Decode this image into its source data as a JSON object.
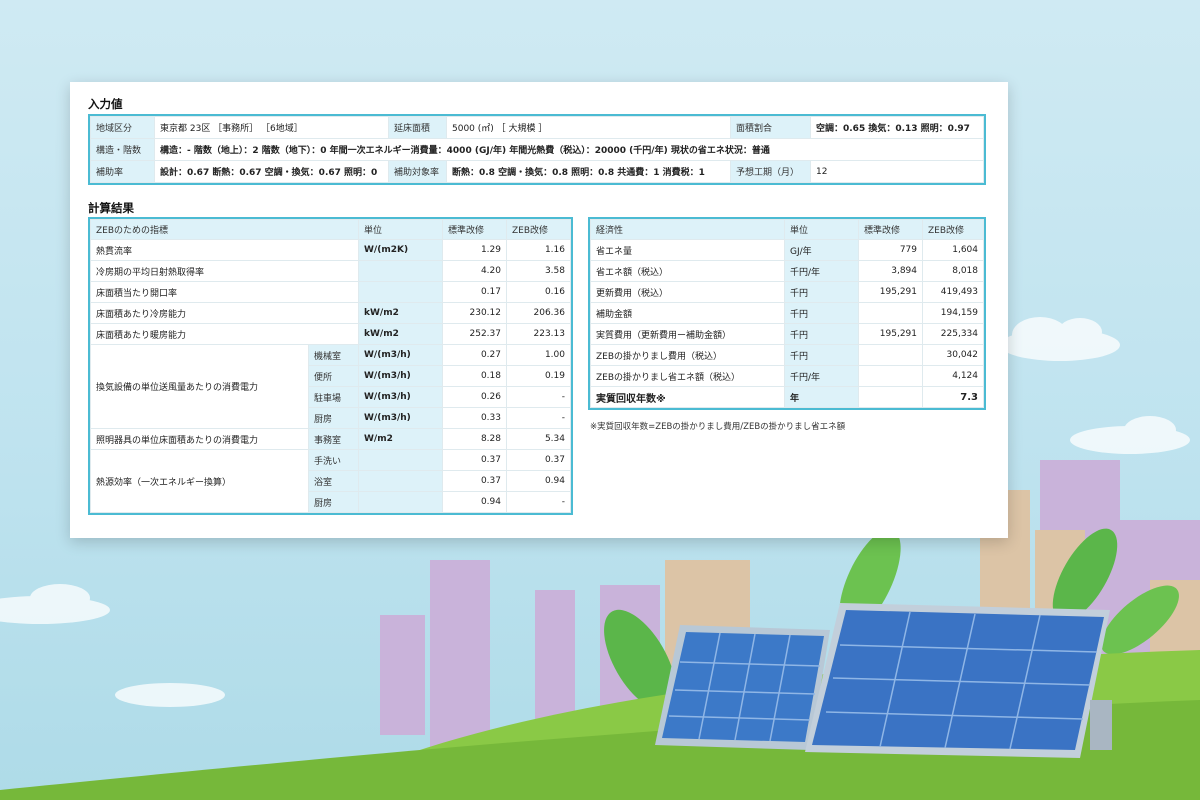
{
  "input": {
    "title": "入力値",
    "row1": {
      "region_label": "地域区分",
      "region_value": "東京都 23区 ［事務所］ ［6地域］",
      "floor_label": "延床面積",
      "floor_value": "5000 (㎡) ［ 大規模 ］",
      "ratio_label": "面積割合",
      "ratio_value": "空調：0.65 換気：0.13 照明：0.97"
    },
    "row2": {
      "structure_label": "構造・階数",
      "structure_value": "構造：- 階数（地上）：2 階数（地下）：0 年間一次エネルギー消費量：4000 (GJ/年) 年間光熱費（税込）：20000 (千円/年) 現状の省エネ状況：普通"
    },
    "row3": {
      "subsidy_label": "補助率",
      "subsidy_value": "設計：0.67 断熱：0.67 空調・換気：0.67 照明：0",
      "target_label": "補助対象率",
      "target_value": "断熱：0.8 空調・換気：0.8 照明：0.8 共通費：1 消費税：1",
      "period_label": "予想工期（月）",
      "period_value": "12"
    }
  },
  "results": {
    "title": "計算結果",
    "left": {
      "headers": [
        "ZEBのための指標",
        "単位",
        "標準改修",
        "ZEB改修"
      ],
      "rows": [
        {
          "name": "熱貫流率",
          "unit": "W/(m2K)",
          "std": "1.29",
          "zeb": "1.16"
        },
        {
          "name": "冷房期の平均日射熱取得率",
          "unit": "",
          "std": "4.20",
          "zeb": "3.58"
        },
        {
          "name": "床面積当たり開口率",
          "unit": "",
          "std": "0.17",
          "zeb": "0.16"
        },
        {
          "name": "床面積あたり冷房能力",
          "unit": "kW/m2",
          "std": "230.12",
          "zeb": "206.36"
        },
        {
          "name": "床面積あたり暖房能力",
          "unit": "kW/m2",
          "std": "252.37",
          "zeb": "223.13"
        }
      ],
      "vent_group": {
        "name": "換気設備の単位送風量あたりの消費電力",
        "rows": [
          {
            "sub": "機械室",
            "unit": "W/(m3/h)",
            "std": "0.27",
            "zeb": "1.00"
          },
          {
            "sub": "便所",
            "unit": "W/(m3/h)",
            "std": "0.18",
            "zeb": "0.19"
          },
          {
            "sub": "駐車場",
            "unit": "W/(m3/h)",
            "std": "0.26",
            "zeb": "-"
          },
          {
            "sub": "厨房",
            "unit": "W/(m3/h)",
            "std": "0.33",
            "zeb": "-"
          }
        ]
      },
      "light_row": {
        "name": "照明器具の単位床面積あたりの消費電力",
        "sub": "事務室",
        "unit": "W/m2",
        "std": "8.28",
        "zeb": "5.34"
      },
      "heat_group": {
        "name": "熱源効率（一次エネルギー換算）",
        "rows": [
          {
            "sub": "手洗い",
            "unit": "",
            "std": "0.37",
            "zeb": "0.37"
          },
          {
            "sub": "浴室",
            "unit": "",
            "std": "0.37",
            "zeb": "0.94"
          },
          {
            "sub": "厨房",
            "unit": "",
            "std": "0.94",
            "zeb": "-"
          }
        ]
      }
    },
    "right": {
      "headers": [
        "経済性",
        "単位",
        "標準改修",
        "ZEB改修"
      ],
      "rows": [
        {
          "name": "省エネ量",
          "unit": "GJ/年",
          "std": "779",
          "zeb": "1,604"
        },
        {
          "name": "省エネ額（税込）",
          "unit": "千円/年",
          "std": "3,894",
          "zeb": "8,018"
        },
        {
          "name": "更新費用（税込）",
          "unit": "千円",
          "std": "195,291",
          "zeb": "419,493"
        },
        {
          "name": "補助金額",
          "unit": "千円",
          "std": "",
          "zeb": "194,159"
        },
        {
          "name": "実質費用（更新費用ー補助金額）",
          "unit": "千円",
          "std": "195,291",
          "zeb": "225,334"
        },
        {
          "name": "ZEBの掛かりまし費用（税込）",
          "unit": "千円",
          "std": "",
          "zeb": "30,042"
        },
        {
          "name": "ZEBの掛かりまし省エネ額（税込）",
          "unit": "千円/年",
          "std": "",
          "zeb": "4,124"
        },
        {
          "name": "実質回収年数※",
          "unit": "年",
          "std": "",
          "zeb": "7.3"
        }
      ],
      "note": "※実質回収年数=ZEBの掛かりまし費用/ZEBの掛かりまし省エネ額"
    }
  },
  "colors": {
    "accent": "#4bbbd3",
    "label_bg": "#ddf2f9"
  }
}
